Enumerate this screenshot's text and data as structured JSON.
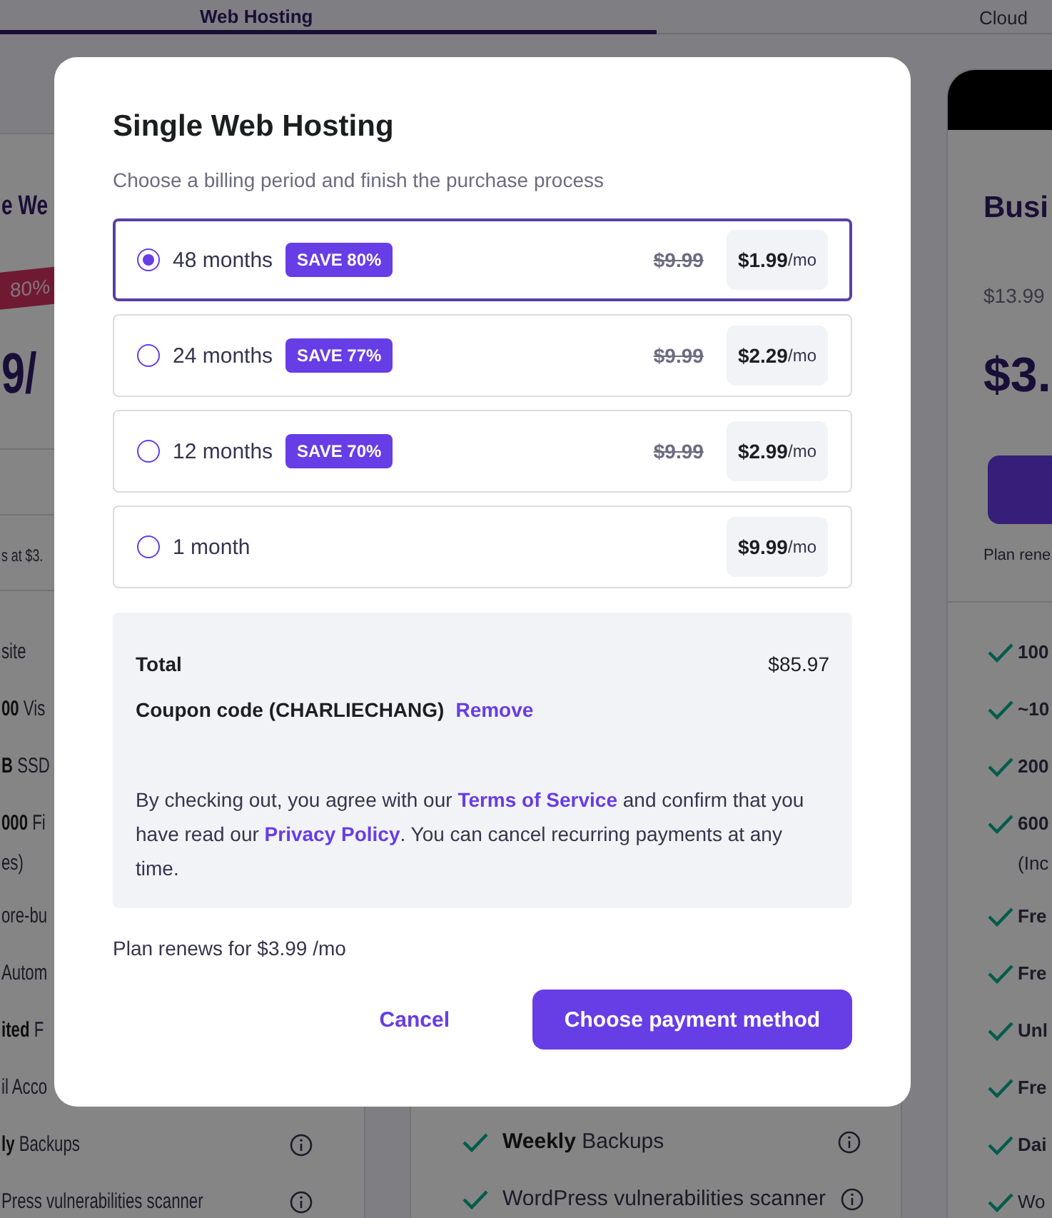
{
  "tabs": [
    {
      "label": "Web Hosting",
      "selected": true
    },
    {
      "label": "Cloud",
      "selected": false
    }
  ],
  "plans": [
    {
      "kind": "full",
      "banner": false,
      "title": "e We",
      "badge": "80%",
      "price": "9/",
      "button": false,
      "renews": "s at $3.",
      "checks": false,
      "features": [
        {
          "text": "site",
          "info": false
        },
        {
          "text": "**00** Vis",
          "info": false
        },
        {
          "text": "**B** SSD",
          "info": false
        },
        {
          "text": "**000** Fi",
          "note": "es)",
          "info": false
        },
        {
          "text": "ore-bu",
          "info": false
        },
        {
          "text": "Autom",
          "info": false
        },
        {
          "text": "**ited** F",
          "info": false
        },
        {
          "text": "il Acco",
          "info": false
        },
        {
          "text": "**ly** Backups",
          "info": true
        },
        {
          "text": "Press vulnerabilities scanner",
          "info": true
        }
      ]
    },
    {
      "kind": "covered",
      "banner": false,
      "button": false,
      "checks": true,
      "features": [
        {
          "text": "**Weekly** Backups",
          "info": true
        },
        {
          "text": "WordPress vulnerabilities scanner",
          "info": true
        }
      ]
    },
    {
      "kind": "full",
      "banner": true,
      "title": "Busi",
      "old_price": "$13.99",
      "price": "$3.",
      "button": true,
      "renews": "Plan rene",
      "checks": true,
      "features": [
        {
          "text": "100",
          "bold": true,
          "info": false
        },
        {
          "text": "~10",
          "bold": true,
          "info": false
        },
        {
          "text": "200",
          "bold": true,
          "info": false
        },
        {
          "text": "600",
          "note": "(Inc",
          "bold": true,
          "info": false
        },
        {
          "text": "Fre",
          "bold": true,
          "info": false
        },
        {
          "text": "Fre",
          "bold": true,
          "info": false
        },
        {
          "text": "Unl",
          "bold": true,
          "info": false
        },
        {
          "text": "Fre",
          "bold": true,
          "info": false
        },
        {
          "text": "Dai",
          "bold": true,
          "info": false
        },
        {
          "text": "Wo",
          "bold": false,
          "info": false
        }
      ]
    }
  ],
  "dialog": {
    "title": "Single Web Hosting",
    "subtitle": "Choose a billing period and finish the purchase process",
    "options": [
      {
        "label": "48 months",
        "badge": "SAVE 80%",
        "old_price": "$9.99",
        "price": "$1.99",
        "unit": "/mo",
        "selected": true
      },
      {
        "label": "24 months",
        "badge": "SAVE 77%",
        "old_price": "$9.99",
        "price": "$2.29",
        "unit": "/mo",
        "selected": false
      },
      {
        "label": "12 months",
        "badge": "SAVE 70%",
        "old_price": "$9.99",
        "price": "$2.99",
        "unit": "/mo",
        "selected": false
      },
      {
        "label": "1 month",
        "price": "$9.99",
        "unit": "/mo",
        "selected": false
      }
    ],
    "summary": {
      "total_label": "Total",
      "total": "$85.97",
      "coupon": "Coupon code (CHARLIECHANG)",
      "coupon_action": "Remove",
      "consent": [
        {
          "kind": "text",
          "text": "By checking out, you agree with our "
        },
        {
          "kind": "link",
          "text": "Terms of Service"
        },
        {
          "kind": "text",
          "text": " and confirm that you have read our "
        },
        {
          "kind": "link",
          "text": "Privacy Policy"
        },
        {
          "kind": "text",
          "text": ". You can cancel recurring payments at any time."
        }
      ]
    },
    "renews": "Plan renews for $3.99 /mo",
    "cancel": "Cancel",
    "submit": "Choose payment method"
  }
}
